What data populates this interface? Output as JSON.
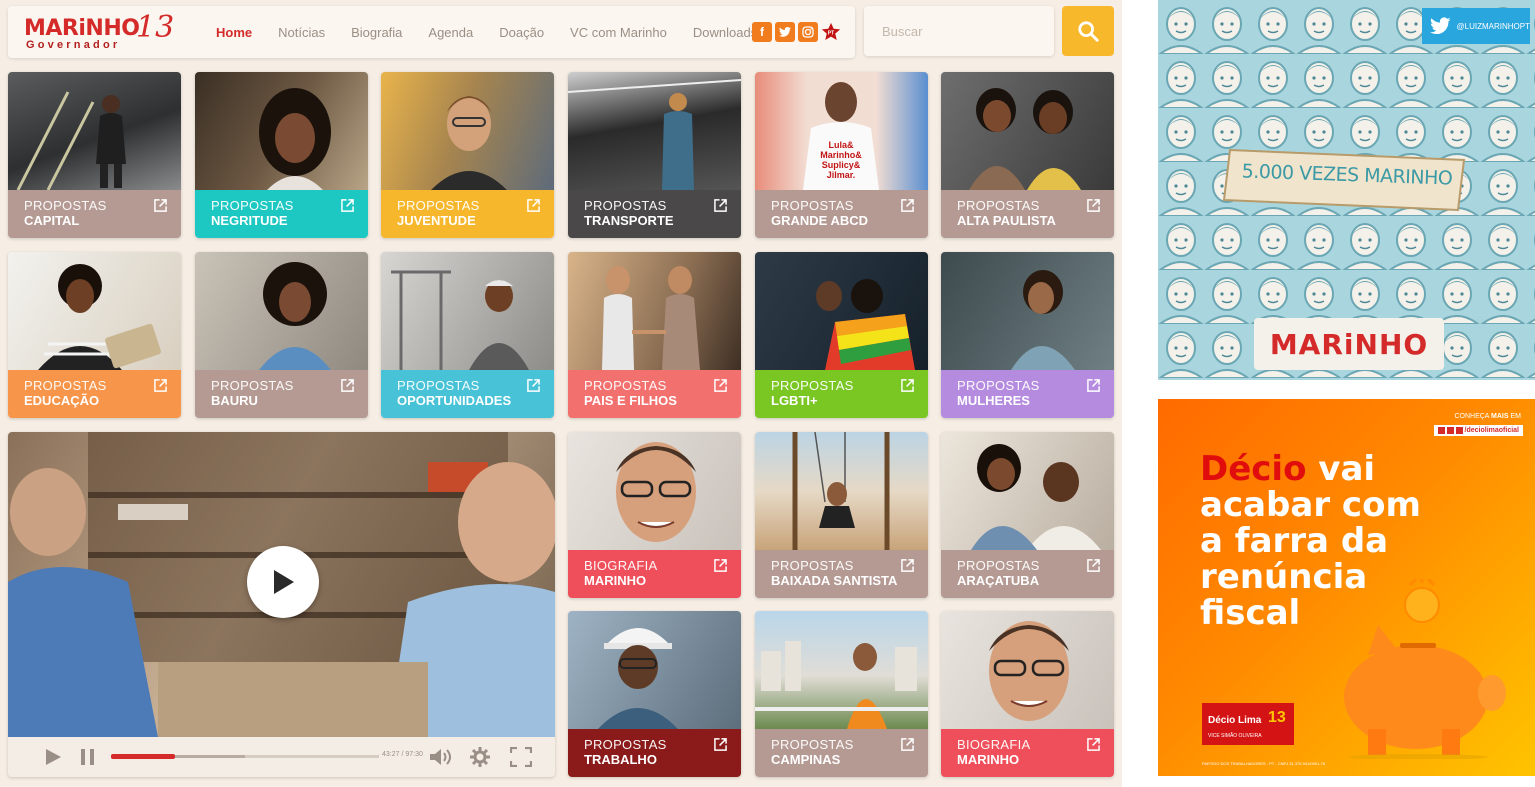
{
  "header": {
    "logo_name": "MARiNHO",
    "logo_number": "13",
    "logo_subtitle": "Governador",
    "nav": [
      "Home",
      "Notícias",
      "Biografia",
      "Agenda",
      "Doação",
      "VC com Marinho",
      "Downloads"
    ],
    "active_nav": "Home",
    "social_icons": [
      "facebook-icon",
      "twitter-icon",
      "instagram-icon",
      "pt-star-icon"
    ],
    "search_placeholder": "Buscar"
  },
  "tiles": [
    {
      "l1": "PROPOSTAS",
      "l2": "CAPITAL",
      "color": "#b59a94"
    },
    {
      "l1": "PROPOSTAS",
      "l2": "NEGRITUDE",
      "color": "#1ec8c2"
    },
    {
      "l1": "PROPOSTAS",
      "l2": "JUVENTUDE",
      "color": "#f6b72c"
    },
    {
      "l1": "PROPOSTAS",
      "l2": "TRANSPORTE",
      "color": "#4a4848"
    },
    {
      "l1": "PROPOSTAS",
      "l2": "GRANDE ABCD",
      "color": "#b59a94"
    },
    {
      "l1": "PROPOSTAS",
      "l2": "ALTA PAULISTA",
      "color": "#b59a94"
    },
    {
      "l1": "PROPOSTAS",
      "l2": "EDUCAÇÃO",
      "color": "#f7954a"
    },
    {
      "l1": "PROPOSTAS",
      "l2": "BAURU",
      "color": "#b59a94"
    },
    {
      "l1": "PROPOSTAS",
      "l2": "OPORTUNIDADES",
      "color": "#47c2d6"
    },
    {
      "l1": "PROPOSTAS",
      "l2": "PAIS E FILHOS",
      "color": "#f2716f"
    },
    {
      "l1": "PROPOSTAS",
      "l2": "LGBTI+",
      "color": "#7ac623"
    },
    {
      "l1": "PROPOSTAS",
      "l2": "MULHERES",
      "color": "#b58be0"
    },
    {
      "l1": "BIOGRAFIA",
      "l2": "MARINHO",
      "color": "#ee4f5a"
    },
    {
      "l1": "PROPOSTAS",
      "l2": "BAIXADA SANTISTA",
      "color": "#b59a94"
    },
    {
      "l1": "PROPOSTAS",
      "l2": "ARAÇATUBA",
      "color": "#b59a94"
    },
    {
      "l1": "PROPOSTAS",
      "l2": "TRABALHO",
      "color": "#8b1a1a"
    },
    {
      "l1": "PROPOSTAS",
      "l2": "CAMPINAS",
      "color": "#b59a94"
    },
    {
      "l1": "BIOGRAFIA",
      "l2": "MARINHO",
      "color": "#ee4f5a"
    }
  ],
  "video": {
    "time": "43:27 / 97:30",
    "progress": 0.24,
    "buffered": 0.5
  },
  "ad_twitter": {
    "handle": "@LUIZMARINHOPT",
    "banner": "5.000 VEZES MARINHO",
    "logo": "MARiNHO"
  },
  "ad_decio": {
    "top_text_1": "CONHEÇA",
    "top_text_2": "MAIS",
    "top_text_3": "EM",
    "handle": "/deciolimaoficial",
    "headline_red": "Décio",
    "headline_rest_1": " vai",
    "headline_2": "acabar com",
    "headline_3": "a farra da",
    "headline_4": "renúncia",
    "headline_5": "fiscal",
    "badge_name": "Décio Lima",
    "badge_number": "13",
    "badge_vice": "VICE SIMÃO OLIVEIRA",
    "footer": "PARTIDO DOS TRABALHADORES - PT - CNPJ 31.375.941/0001-76"
  }
}
